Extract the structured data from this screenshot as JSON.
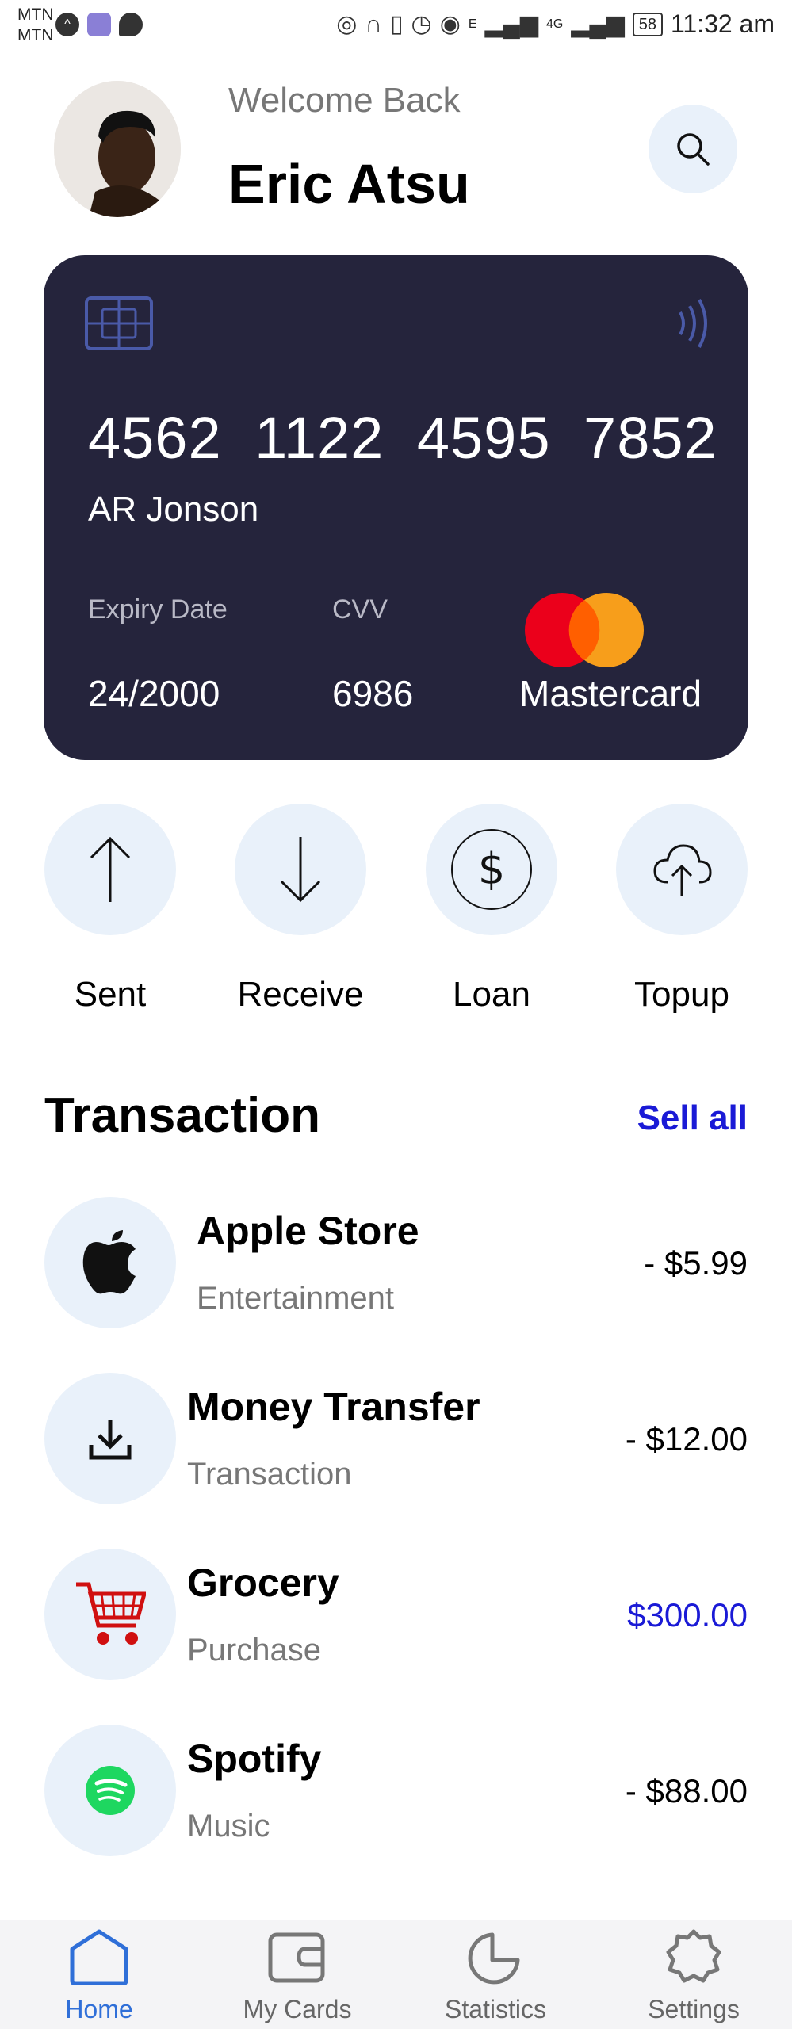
{
  "status_bar": {
    "carrier_1": "MTN",
    "carrier_2": "MTN",
    "network_e": "E",
    "network_4g": "4G",
    "battery": "58",
    "time": "11:32 am"
  },
  "header": {
    "welcome": "Welcome Back",
    "user_name": "Eric Atsu"
  },
  "card": {
    "number": "4562 1122 4595 7852",
    "holder": "AR Jonson",
    "expiry_label": "Expiry Date",
    "expiry_value": "24/2000",
    "cvv_label": "CVV",
    "cvv_value": "6986",
    "brand": "Mastercard",
    "colors": {
      "background": "#25243c",
      "mc_red": "#eb001b",
      "mc_orange": "#f79e1b"
    }
  },
  "actions": [
    {
      "label": "Sent",
      "icon": "arrow-up-icon"
    },
    {
      "label": "Receive",
      "icon": "arrow-down-icon"
    },
    {
      "label": "Loan",
      "icon": "dollar-icon"
    },
    {
      "label": "Topup",
      "icon": "cloud-upload-icon"
    }
  ],
  "transactions_section": {
    "title": "Transaction",
    "see_all": "Sell all"
  },
  "transactions": [
    {
      "title": "Apple Store",
      "subtitle": "Entertainment",
      "amount": "- $5.99",
      "icon": "apple-icon"
    },
    {
      "title": "Money Transfer",
      "subtitle": "Transaction",
      "amount": "- $12.00",
      "icon": "download-icon"
    },
    {
      "title": "Grocery",
      "subtitle": "Purchase",
      "amount": "$300.00",
      "icon": "cart-icon"
    },
    {
      "title": "Spotify",
      "subtitle": "Music",
      "amount": "- $88.00",
      "icon": "spotify-icon"
    }
  ],
  "bottom_nav": [
    {
      "label": "Home",
      "icon": "home-icon",
      "active": true
    },
    {
      "label": "My Cards",
      "icon": "wallet-icon",
      "active": false
    },
    {
      "label": "Statistics",
      "icon": "pie-chart-icon",
      "active": false
    },
    {
      "label": "Settings",
      "icon": "gear-icon",
      "active": false
    }
  ],
  "colors": {
    "accent": "#1a1ad6",
    "nav_active": "#2f6fd8",
    "icon_bg": "#e9f1fa"
  }
}
